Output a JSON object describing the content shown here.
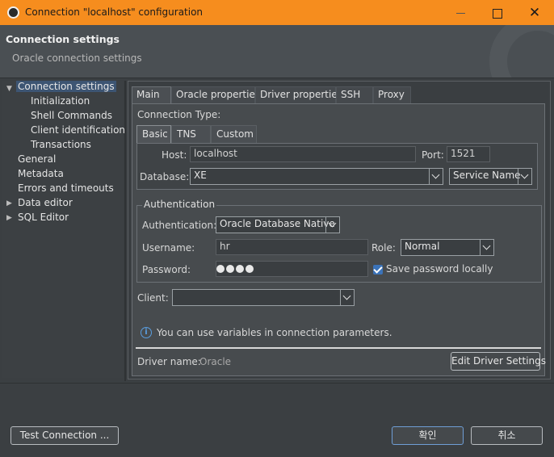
{
  "window": {
    "title": "Connection \"localhost\" configuration",
    "close_glyph": "✕"
  },
  "header": {
    "title": "Connection settings",
    "subtitle": "Oracle connection settings"
  },
  "tree": {
    "items": [
      {
        "label": "Connection settings",
        "selected": true
      },
      {
        "label": "Initialization"
      },
      {
        "label": "Shell Commands"
      },
      {
        "label": "Client identification"
      },
      {
        "label": "Transactions"
      },
      {
        "label": "General"
      },
      {
        "label": "Metadata"
      },
      {
        "label": "Errors and timeouts"
      },
      {
        "label": "Data editor"
      },
      {
        "label": "SQL Editor"
      }
    ]
  },
  "tabs": [
    "Main",
    "Oracle properties",
    "Driver properties",
    "SSH",
    "Proxy"
  ],
  "main": {
    "connection_type_label": "Connection Type:",
    "subtabs": [
      "Basic",
      "TNS",
      "Custom"
    ],
    "host_label": "Host:",
    "host_value": "localhost",
    "port_label": "Port:",
    "port_value": "1521",
    "database_label": "Database:",
    "database_value": "XE",
    "service_value": "Service Name",
    "auth_group_title": "Authentication",
    "auth_label": "Authentication:",
    "auth_value": "Oracle Database Native",
    "username_label": "Username:",
    "username_value": "hr",
    "role_label": "Role:",
    "role_value": "Normal",
    "password_label": "Password:",
    "save_password_label": "Save password locally",
    "client_label": "Client:",
    "client_value": "",
    "info_text": "You can use variables in connection parameters.",
    "driver_label": "Driver name:",
    "driver_value": "Oracle",
    "edit_driver_label": "Edit Driver Settings"
  },
  "footer": {
    "test_connection_label": "Test Connection ...",
    "ok_label": "확인",
    "cancel_label": "취소"
  },
  "colors": {
    "titlebar": "#f68d1e",
    "selection": "#3d5573",
    "checkbox": "#3b73b9"
  }
}
